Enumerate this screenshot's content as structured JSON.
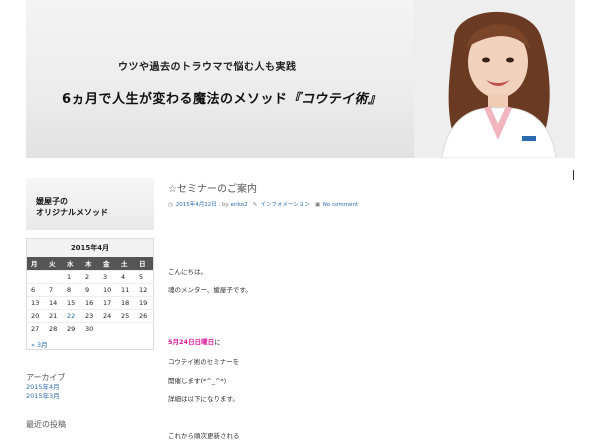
{
  "banner": {
    "subtitle": "ウツや過去のトラウマで悩む人も実践",
    "headline_prefix": "6ヵ月で人生が変わる魔法のメソッド",
    "headline_accent": "『コウテイ術』"
  },
  "sidebar": {
    "title_line1": "媛屋子の",
    "title_line2": "オリジナルメソッド",
    "calendar": {
      "caption": "2015年4月",
      "weekdays": [
        "月",
        "火",
        "水",
        "木",
        "金",
        "土",
        "日"
      ],
      "weeks": [
        [
          "",
          "",
          "1",
          "2",
          "3",
          "4",
          "5"
        ],
        [
          "6",
          "7",
          "8",
          "9",
          "10",
          "11",
          "12"
        ],
        [
          "13",
          "14",
          "15",
          "16",
          "17",
          "18",
          "19"
        ],
        [
          "20",
          "21",
          "22",
          "23",
          "24",
          "25",
          "26"
        ],
        [
          "27",
          "28",
          "29",
          "30",
          "",
          "",
          ""
        ]
      ],
      "today": "22",
      "prev_link": "« 3月"
    },
    "archive_title": "アーカイブ",
    "archive_links": [
      "2015年4月",
      "2015年3月"
    ],
    "recent_title": "最近の投稿"
  },
  "post": {
    "title": "☆セミナーのご案内",
    "date": "2015年4月22日",
    "by": ", by",
    "author": "eriko2",
    "category": "インフォメーション",
    "comments": "No comment",
    "lines": {
      "greeting": "こんにちは。",
      "intro": "魂のメンター、媛屋子です。",
      "date_bold": "5月24日日曜日",
      "date_tail": "に",
      "seminar": "コウテイ術のセミナーを",
      "hold": "開催します(*^_^*)",
      "details": "詳細は以下になります。",
      "next": "これから順次更新される"
    }
  },
  "colors": {
    "link": "#2b6cb0",
    "highlight": "#d81b9c",
    "calendar_header": "#555555"
  }
}
